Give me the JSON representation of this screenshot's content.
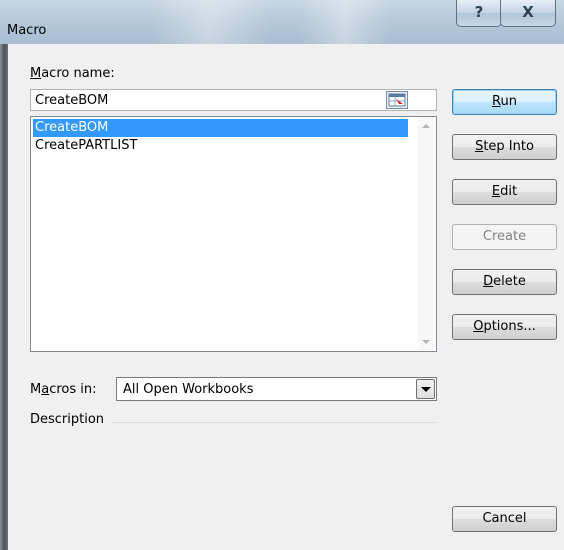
{
  "window": {
    "title": "Macro",
    "help_glyph": "?",
    "close_glyph": "X"
  },
  "macro_name": {
    "label_mnemonic": "M",
    "label_rest": "acro name:",
    "value": "CreateBOM"
  },
  "macro_list": {
    "items": [
      {
        "label": "CreateBOM",
        "selected": true
      },
      {
        "label": "CreatePARTLIST",
        "selected": false
      }
    ]
  },
  "buttons": {
    "run": {
      "mnemonic": "R",
      "rest": "un"
    },
    "step_into": {
      "mnemonic": "S",
      "rest": "tep Into"
    },
    "edit": {
      "mnemonic": "E",
      "rest": "dit"
    },
    "create": {
      "label": "Create"
    },
    "delete": {
      "mnemonic": "D",
      "rest": "elete"
    },
    "options": {
      "mnemonic": "O",
      "rest": "ptions..."
    },
    "cancel": {
      "label": "Cancel"
    }
  },
  "macros_in": {
    "label_pre": "M",
    "label_mnemonic": "a",
    "label_post": "cros in:",
    "value": "All Open Workbooks"
  },
  "description": {
    "label": "Description"
  }
}
